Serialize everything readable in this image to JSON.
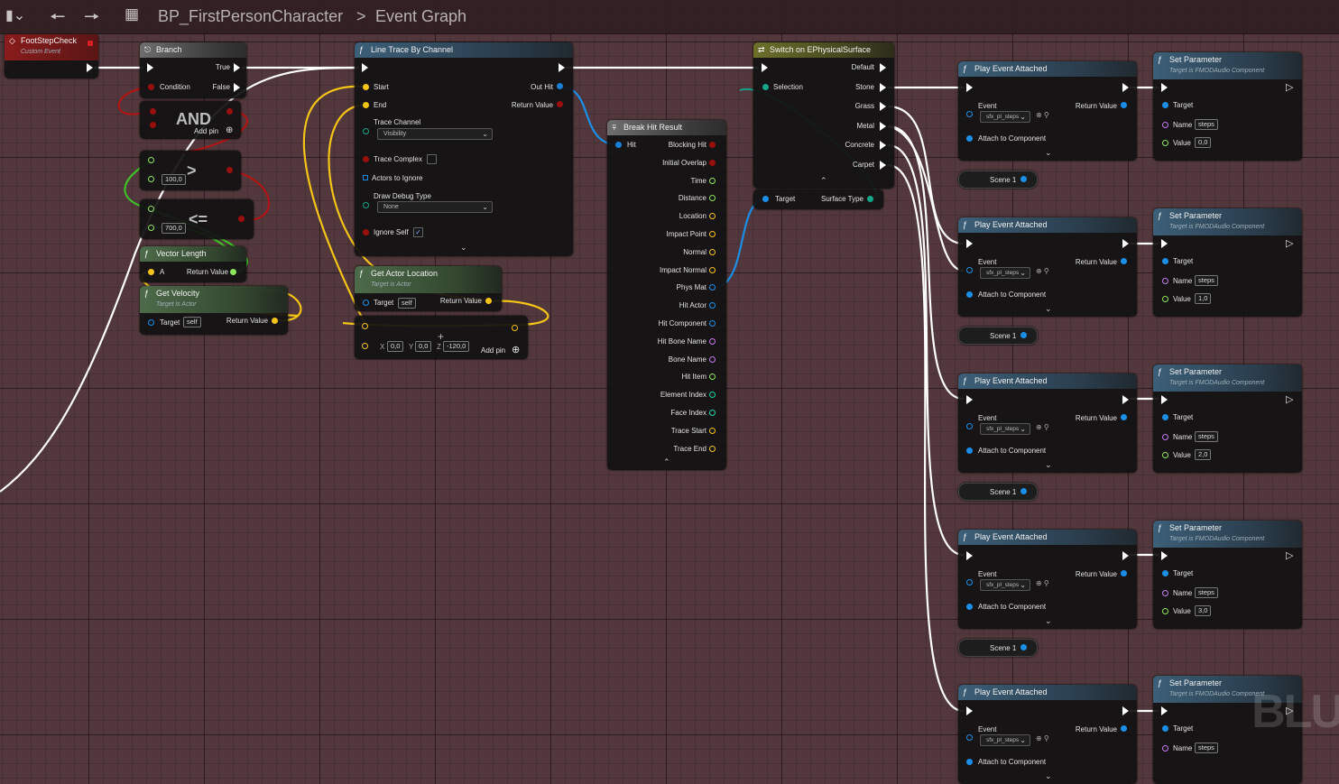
{
  "toolbar": {
    "bookmark_icon": "bookmark-icon",
    "back_icon": "arrow-left-icon",
    "forward_icon": "arrow-right-icon",
    "blueprint_name": "BP_FirstPersonCharacter",
    "separator": ">",
    "graph_name": "Event Graph"
  },
  "colors": {
    "exec": "#ffffff",
    "bool": "#9a0e0e",
    "vector": "#f4c417",
    "float": "#8ee65a",
    "object": "#1b8fe8",
    "struct": "#1a7fd8",
    "name": "#c67bf0",
    "int": "#19d7a9"
  },
  "nodes": {
    "footstep": {
      "title": "FootStepCheck",
      "sub": "Custom Event"
    },
    "branch": {
      "title": "Branch",
      "condition": "Condition",
      "true": "True",
      "false": "False"
    },
    "and": {
      "op": "AND",
      "add_pin": "Add pin"
    },
    "greater": {
      "op": ">",
      "value": "100,0"
    },
    "lesseq": {
      "op": "<=",
      "value": "700,0"
    },
    "vector_length": {
      "title": "Vector Length",
      "a": "A",
      "return": "Return Value"
    },
    "get_velocity": {
      "title": "Get Velocity",
      "sub": "Target is Actor",
      "target": "Target",
      "target_val": "self",
      "return": "Return Value"
    },
    "line_trace": {
      "title": "Line Trace By Channel",
      "start": "Start",
      "end": "End",
      "out_hit": "Out Hit",
      "return": "Return Value",
      "trace_channel": "Trace Channel",
      "trace_channel_val": "Visibility",
      "trace_complex": "Trace Complex",
      "actors_ignore": "Actors to Ignore",
      "draw_debug": "Draw Debug Type",
      "draw_debug_val": "None",
      "ignore_self": "Ignore Self"
    },
    "get_actor_location": {
      "title": "Get Actor Location",
      "sub": "Target is Actor",
      "target": "Target",
      "target_val": "self",
      "return": "Return Value"
    },
    "add": {
      "x": "0,0",
      "y": "0,0",
      "z": "-120,0",
      "add_pin": "Add pin"
    },
    "break_hit": {
      "title": "Break Hit Result",
      "hit": "Hit",
      "outputs": [
        "Blocking Hit",
        "Initial Overlap",
        "Time",
        "Distance",
        "Location",
        "Impact Point",
        "Normal",
        "Impact Normal",
        "Phys Mat",
        "Hit Actor",
        "Hit Component",
        "Hit Bone Name",
        "Bone Name",
        "Hit Item",
        "Element Index",
        "Face Index",
        "Trace Start",
        "Trace End"
      ]
    },
    "switch": {
      "title": "Switch on EPhysicalSurface",
      "selection": "Selection",
      "outputs": [
        "Default",
        "Stone",
        "Grass",
        "Metal",
        "Concrete",
        "Carpet"
      ]
    },
    "surface_type": {
      "target": "Target",
      "surface": "Surface Type"
    },
    "play_event": {
      "title": "Play Event Attached",
      "event": "Event",
      "event_val": "sfx_pl_steps",
      "return": "Return Value",
      "attach": "Attach to Component",
      "scene": "Scene 1"
    },
    "set_param": {
      "title": "Set Parameter",
      "sub": "Target is FMODAudio Component",
      "target": "Target",
      "name": "Name",
      "name_val": "steps",
      "value": "Value",
      "values": [
        "0,0",
        "1,0",
        "2,0",
        "3,0"
      ]
    }
  },
  "watermark": "BLU"
}
